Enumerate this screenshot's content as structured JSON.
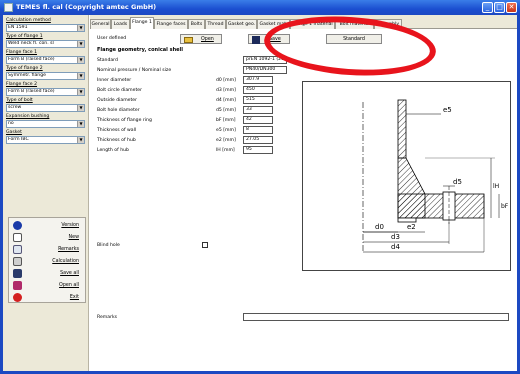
{
  "window": {
    "title": "TEMES fl. cal (Copyright amtec GmbH)",
    "minimize_glyph": "_",
    "maximize_glyph": "□",
    "close_glyph": "✕"
  },
  "sidebar": {
    "calc_method_label": "Calculation method",
    "calc_method_value": "EN 1591",
    "flange1_type_label": "Type of flange 1",
    "flange1_type_value": "Weld neck fl. con. sl",
    "flange_face1_label": "Flange face 1",
    "flange_face1_value": "Form B (raised face)",
    "flange2_type_label": "Type of flange 2",
    "flange2_type_value": "Symmetr. flange",
    "flange_face2_label": "Flange face 2",
    "flange_face2_value": "Form B (raised face)",
    "bolt_type_label": "Type of bolt",
    "bolt_type_value": "screw",
    "bushing_label": "Expansion bushing",
    "bushing_value": "no",
    "gasket_label": "Gasket",
    "gasket_value": "Form IBC",
    "buttons": {
      "version": "Version",
      "new": "New",
      "remarks": "Remarks",
      "calculation": "Calculation",
      "save_all": "Save all",
      "open_all": "Open all",
      "exit": "Exit"
    },
    "arrow_glyph": "▼"
  },
  "tabs": [
    "General",
    "Loads",
    "Flange 1",
    "Flange faces",
    "Bolts",
    "Thread",
    "Gasket geo.",
    "Gasket mat.",
    "Flange 1 material",
    "Bolt material",
    "Assembly"
  ],
  "flange": {
    "user_defined_label": "User defined",
    "open_label": "Open",
    "save_label": "Save",
    "standard_button": "Standard",
    "section_title": "Flange geometry, conical shell",
    "standard_label": "Standard",
    "standard_value": "prEN 1092-1 (2002)",
    "nominal_label": "Nominal pressure / Nominal size",
    "nominal_value": "PN40/DN300",
    "rows": [
      {
        "label": "Inner diameter",
        "symbol": "d0 [mm]",
        "value": "307.9"
      },
      {
        "label": "Bolt circle diameter",
        "symbol": "d3 [mm]",
        "value": "450"
      },
      {
        "label": "Outside diameter",
        "symbol": "d4 [mm]",
        "value": "515"
      },
      {
        "label": "Bolt hole diameter",
        "symbol": "d5 [mm]",
        "value": "33"
      },
      {
        "label": "Thickness of flange ring",
        "symbol": "bF [mm]",
        "value": "42"
      },
      {
        "label": "Thickness of wall",
        "symbol": "e5 [mm]",
        "value": "8"
      },
      {
        "label": "Thickness of hub",
        "symbol": "e2 [mm]",
        "value": "27.05"
      },
      {
        "label": "Length of hub",
        "symbol": "lH [mm]",
        "value": "95"
      }
    ],
    "blind_hole_label": "Blind hole",
    "remarks_label": "Remarks",
    "remarks_value": ""
  },
  "drawing_labels": {
    "e5": "e5",
    "d5": "d5",
    "d0": "d0",
    "e2": "e2",
    "d3": "d3",
    "d4": "d4",
    "lH": "lH",
    "bF": "bF"
  },
  "colors": {
    "titlebar": "#1b4fd0",
    "annotation_ellipse": "#e8141c",
    "panel": "#ece9d8"
  }
}
